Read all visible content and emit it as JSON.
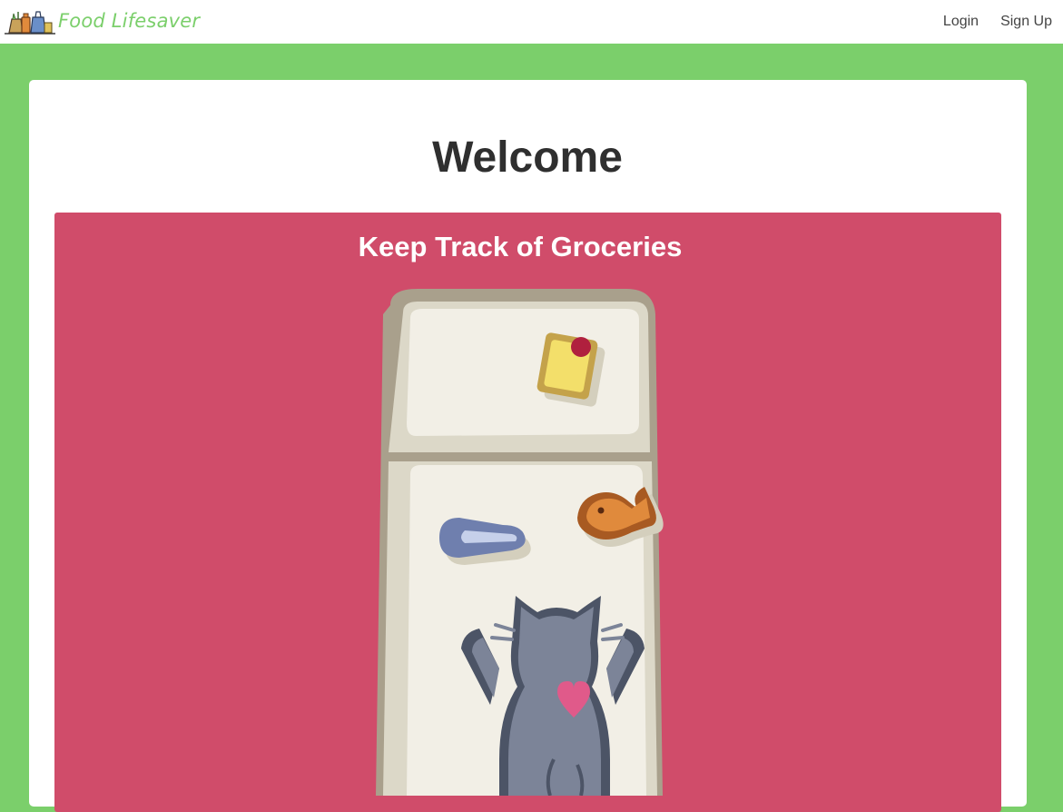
{
  "navbar": {
    "brand_name": "Food Lifesaver",
    "logo_icon": "grocery-bags-icon",
    "links": [
      {
        "label": "Login"
      },
      {
        "label": "Sign Up"
      }
    ]
  },
  "main": {
    "title": "Welcome",
    "feature": {
      "title": "Keep Track of Groceries",
      "illustration": "cat-at-fridge-illustration"
    }
  },
  "colors": {
    "page_background": "#7bcf6b",
    "brand_text": "#7bcf6b",
    "feature_background": "#d04c6a",
    "card_background": "#ffffff"
  }
}
